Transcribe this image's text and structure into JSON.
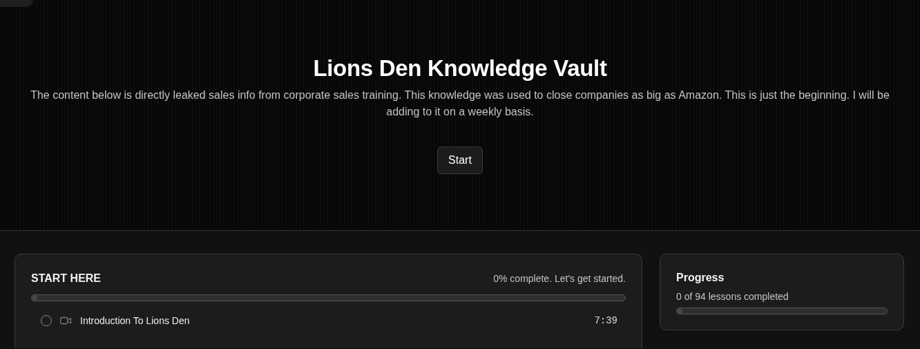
{
  "hero": {
    "title": "Lions Den Knowledge Vault",
    "description": "The content below is directly leaked sales info from corporate sales training. This knowledge was used to close companies as big as Amazon. This is just the beginning. I will be adding to it on a weekly basis.",
    "start_button": "Start"
  },
  "module": {
    "title": "START HERE",
    "status": "0% complete. Let's get started.",
    "level": 0,
    "lessons": [
      {
        "title": "Introduction To Lions Den",
        "kind": "video",
        "completed": false,
        "duration": "7:39"
      }
    ]
  },
  "progress": {
    "title": "Progress",
    "summary": "0 of 94 lessons completed",
    "level": 0
  }
}
